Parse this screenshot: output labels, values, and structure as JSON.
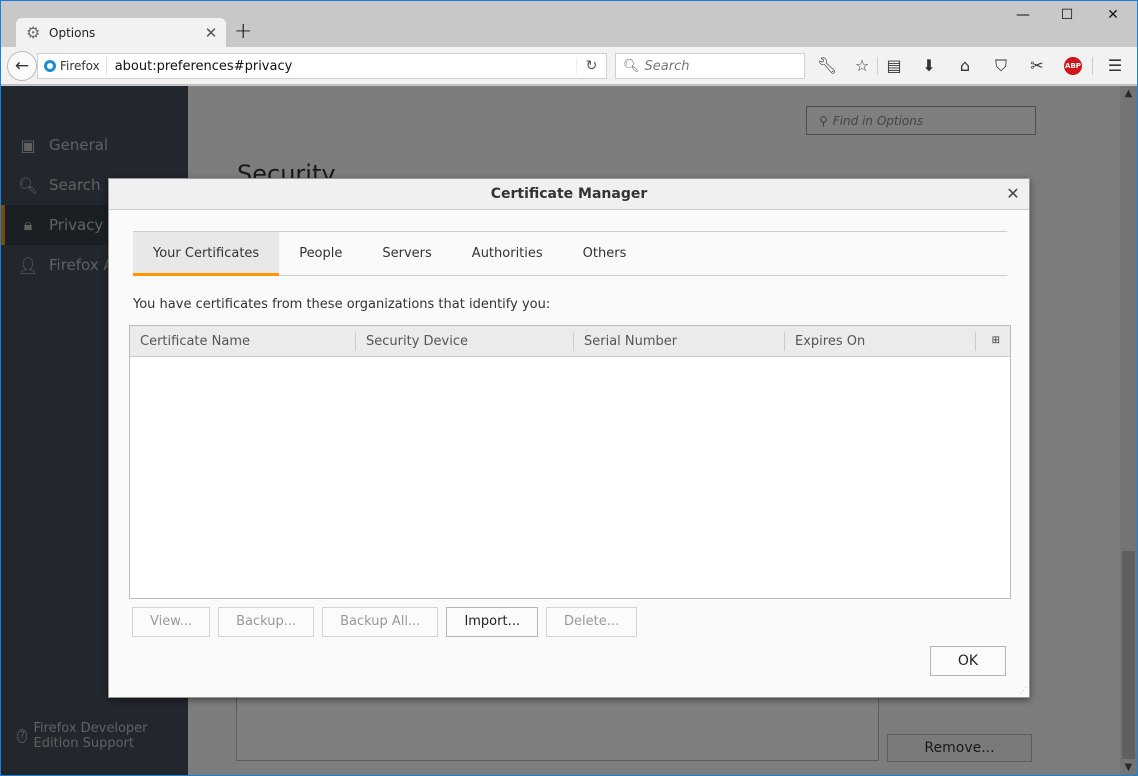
{
  "browser": {
    "tab": {
      "title": "Options",
      "icon": "gear-icon"
    },
    "new_tab_label": "+",
    "window_controls": {
      "minimize": "—",
      "maximize": "☐",
      "close": "✕"
    },
    "identity_label": "Firefox",
    "url": "about:preferences#privacy",
    "search_placeholder": "Search",
    "toolbar_icons": [
      "wrench-icon",
      "bookmark-star-icon",
      "reading-list-icon",
      "download-icon",
      "home-icon",
      "pocket-icon",
      "screenshot-icon",
      "adblock-plus-icon",
      "menu-icon"
    ],
    "abp_label": "ABP"
  },
  "preferences": {
    "sidebar": {
      "items": [
        {
          "label": "General",
          "icon": "general-icon"
        },
        {
          "label": "Search",
          "icon": "search-icon"
        },
        {
          "label": "Privacy & Security",
          "icon": "lock-icon",
          "active": true
        },
        {
          "label": "Firefox Account",
          "icon": "account-icon"
        }
      ],
      "support_label": "Firefox Developer Edition Support"
    },
    "find_placeholder": "Find in Options",
    "section_heading": "Security",
    "remove_button": "Remove..."
  },
  "dialog": {
    "title": "Certificate Manager",
    "tabs": [
      {
        "label": "Your Certificates",
        "selected": true
      },
      {
        "label": "People"
      },
      {
        "label": "Servers"
      },
      {
        "label": "Authorities"
      },
      {
        "label": "Others"
      }
    ],
    "intro_text": "You have certificates from these organizations that identify you:",
    "columns": [
      "Certificate Name",
      "Security Device",
      "Serial Number",
      "Expires On"
    ],
    "rows": [],
    "buttons": [
      {
        "label": "View...",
        "enabled": false
      },
      {
        "label": "Backup...",
        "enabled": false
      },
      {
        "label": "Backup All...",
        "enabled": false
      },
      {
        "label": "Import...",
        "enabled": true
      },
      {
        "label": "Delete...",
        "enabled": false
      }
    ],
    "ok_label": "OK"
  },
  "colors": {
    "accent": "#ff9500",
    "sidebar_bg": "#424f5a",
    "abp_red": "#d0131c"
  }
}
